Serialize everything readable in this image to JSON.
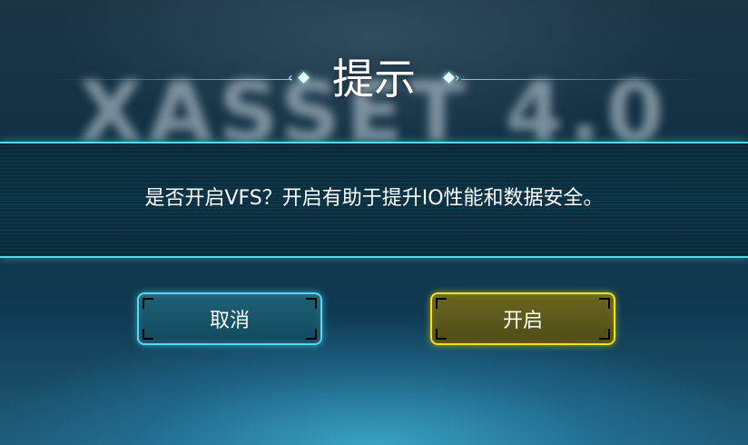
{
  "background": {
    "logo_text": "XASSET 4.0"
  },
  "dialog": {
    "title": "提示",
    "message": "是否开启VFS？开启有助于提升IO性能和数据安全。",
    "cancel_label": "取消",
    "confirm_label": "开启"
  },
  "colors": {
    "cancel_border": "#56d8f3",
    "confirm_border": "#f4e21c",
    "banner_border": "#53d9ee"
  }
}
